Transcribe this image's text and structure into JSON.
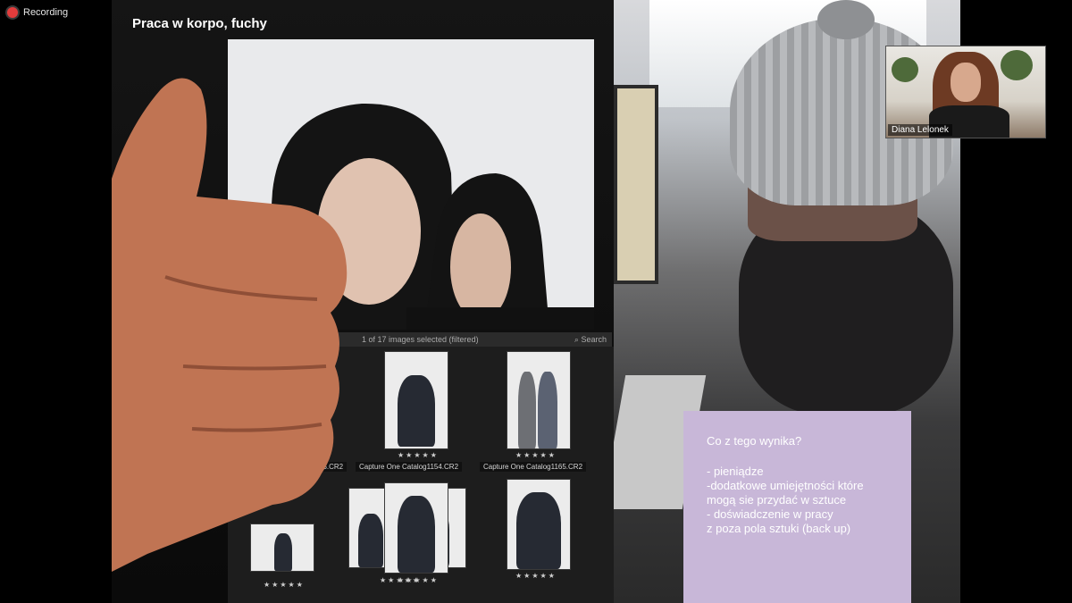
{
  "recording": {
    "label": "Recording"
  },
  "slide": {
    "title": "Praca w korpo, fuchy",
    "viewer": {
      "selection_status": "1 of 17 images selected (filtered)",
      "search_label": "Search",
      "thumbnails": [
        {
          "filename": "43.CR2",
          "rating": "★★★★★"
        },
        {
          "filename": "Capture One Catalog1154.CR2",
          "rating": "★★★★★"
        },
        {
          "filename": "Capture One Catalog1165.CR2",
          "rating": "★★★★★"
        },
        {
          "rating": "★★★★★"
        },
        {
          "rating": "★★★★★"
        },
        {
          "rating": "★★★★★"
        },
        {
          "rating": "★★★★★"
        }
      ]
    },
    "callout": {
      "heading": "Co z tego wynika?",
      "lines": [
        "- pieniądze",
        "-dodatkowe umiejętności które",
        "mogą sie przydać w sztuce",
        "- doświadczenie w pracy",
        "z poza pola sztuki (back up)"
      ]
    }
  },
  "participant": {
    "name": "Diana Lelonek"
  },
  "colors": {
    "callout_bg": "#c8b7d8",
    "recording_dot": "#e23c3c"
  }
}
